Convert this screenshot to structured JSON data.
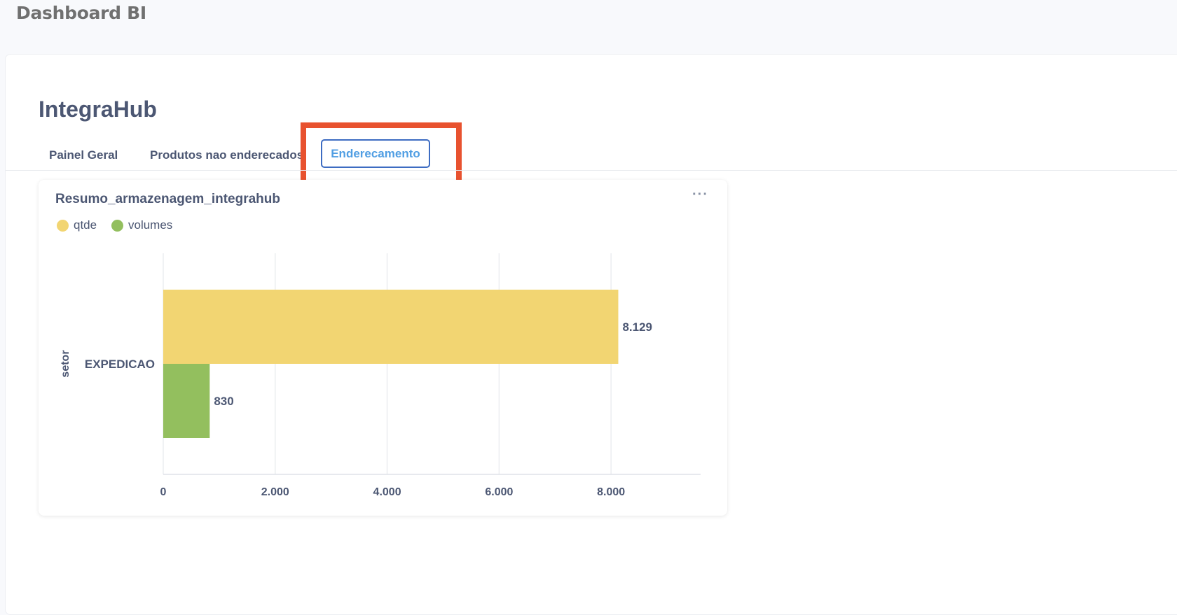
{
  "app": {
    "title": "Dashboard BI"
  },
  "dashboard": {
    "title": "IntegraHub",
    "tabs": [
      {
        "label": "Painel Geral",
        "active": false
      },
      {
        "label": "Produtos nao enderecados",
        "active": false
      },
      {
        "label": "Enderecamento",
        "active": true
      }
    ]
  },
  "card": {
    "title": "Resumo_armazenagem_integrahub",
    "menu_icon": "more-horizontal-icon"
  },
  "colors": {
    "qtde": "#f2d572",
    "volumes": "#93bf5e",
    "active_tab_border": "#3d6cc2",
    "active_tab_text": "#509ee3",
    "highlight": "#e8522f"
  },
  "chart_data": {
    "type": "bar",
    "orientation": "horizontal",
    "categories": [
      "EXPEDICAO"
    ],
    "series": [
      {
        "name": "qtde",
        "values": [
          8129
        ],
        "value_labels": [
          "8.129"
        ]
      },
      {
        "name": "volumes",
        "values": [
          830
        ],
        "value_labels": [
          "830"
        ]
      }
    ],
    "ylabel": "setor",
    "xlabel": "",
    "xlim": [
      0,
      9600
    ],
    "xticks": [
      0,
      2000,
      4000,
      6000,
      8000
    ],
    "xtick_labels": [
      "0",
      "2.000",
      "4.000",
      "6.000",
      "8.000"
    ],
    "grid": true,
    "legend_position": "top-left"
  }
}
